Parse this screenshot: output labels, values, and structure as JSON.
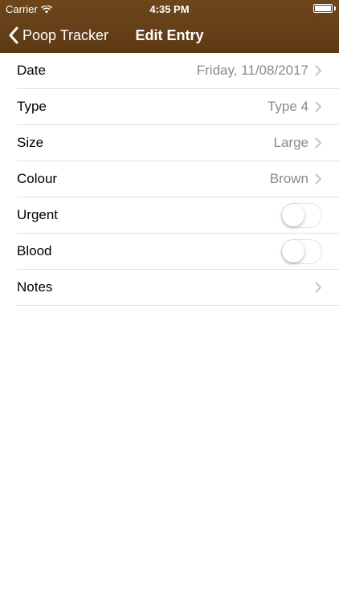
{
  "status_bar": {
    "carrier": "Carrier",
    "time": "4:35 PM",
    "battery_level": 1.0
  },
  "nav": {
    "back_label": "Poop Tracker",
    "title": "Edit Entry"
  },
  "colors": {
    "nav_background": "#6b4419",
    "value_text": "#8a8a8a",
    "separator": "#e1e1e1"
  },
  "rows": [
    {
      "label": "Date",
      "value": "Friday, 11/08/2017",
      "kind": "disclosure"
    },
    {
      "label": "Type",
      "value": "Type 4",
      "kind": "disclosure"
    },
    {
      "label": "Size",
      "value": "Large",
      "kind": "disclosure"
    },
    {
      "label": "Colour",
      "value": "Brown",
      "kind": "disclosure"
    },
    {
      "label": "Urgent",
      "on": false,
      "kind": "toggle"
    },
    {
      "label": "Blood",
      "on": false,
      "kind": "toggle"
    },
    {
      "label": "Notes",
      "value": "",
      "kind": "disclosure"
    }
  ]
}
